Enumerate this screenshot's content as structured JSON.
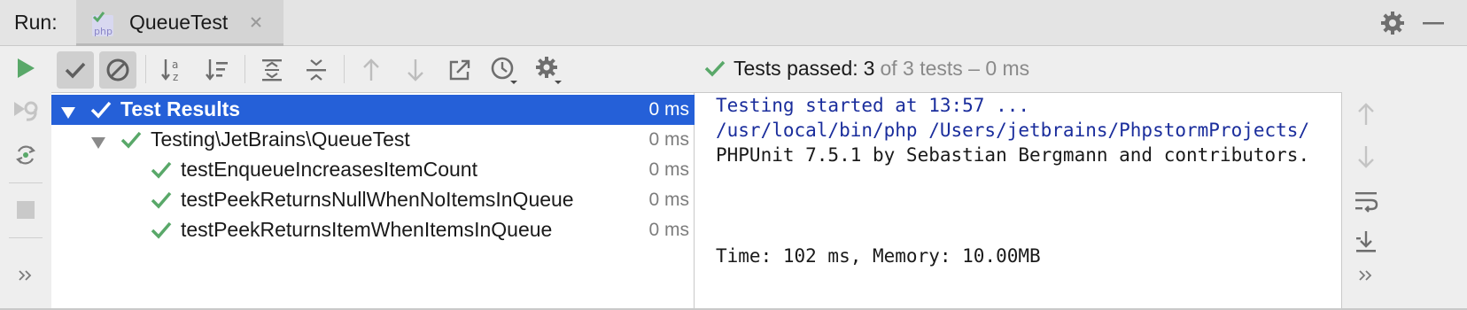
{
  "header": {
    "run_label": "Run:",
    "tab_title": "QueueTest",
    "tab_icon": "php-icon"
  },
  "toolbar": {
    "status_label": "Tests passed:",
    "passed_count": "3",
    "status_rest": "of 3 tests – 0 ms"
  },
  "tree": {
    "rows": [
      {
        "name": "Test Results",
        "time": "0 ms"
      },
      {
        "name": "Testing\\JetBrains\\QueueTest",
        "time": "0 ms"
      },
      {
        "name": "testEnqueueIncreasesItemCount",
        "time": "0 ms"
      },
      {
        "name": "testPeekReturnsNullWhenNoItemsInQueue",
        "time": "0 ms"
      },
      {
        "name": "testPeekReturnsItemWhenItemsInQueue",
        "time": "0 ms"
      }
    ]
  },
  "console": {
    "lines": [
      "Testing started at 13:57 ...",
      "/usr/local/bin/php /Users/jetbrains/PhpstormProjects/",
      "PHPUnit 7.5.1 by Sebastian Bergmann and contributors.",
      "Time: 102 ms, Memory: 10.00MB"
    ]
  },
  "colors": {
    "selection": "#2560d8",
    "success_green": "#59a869",
    "console_blue": "#1a2d9c"
  }
}
